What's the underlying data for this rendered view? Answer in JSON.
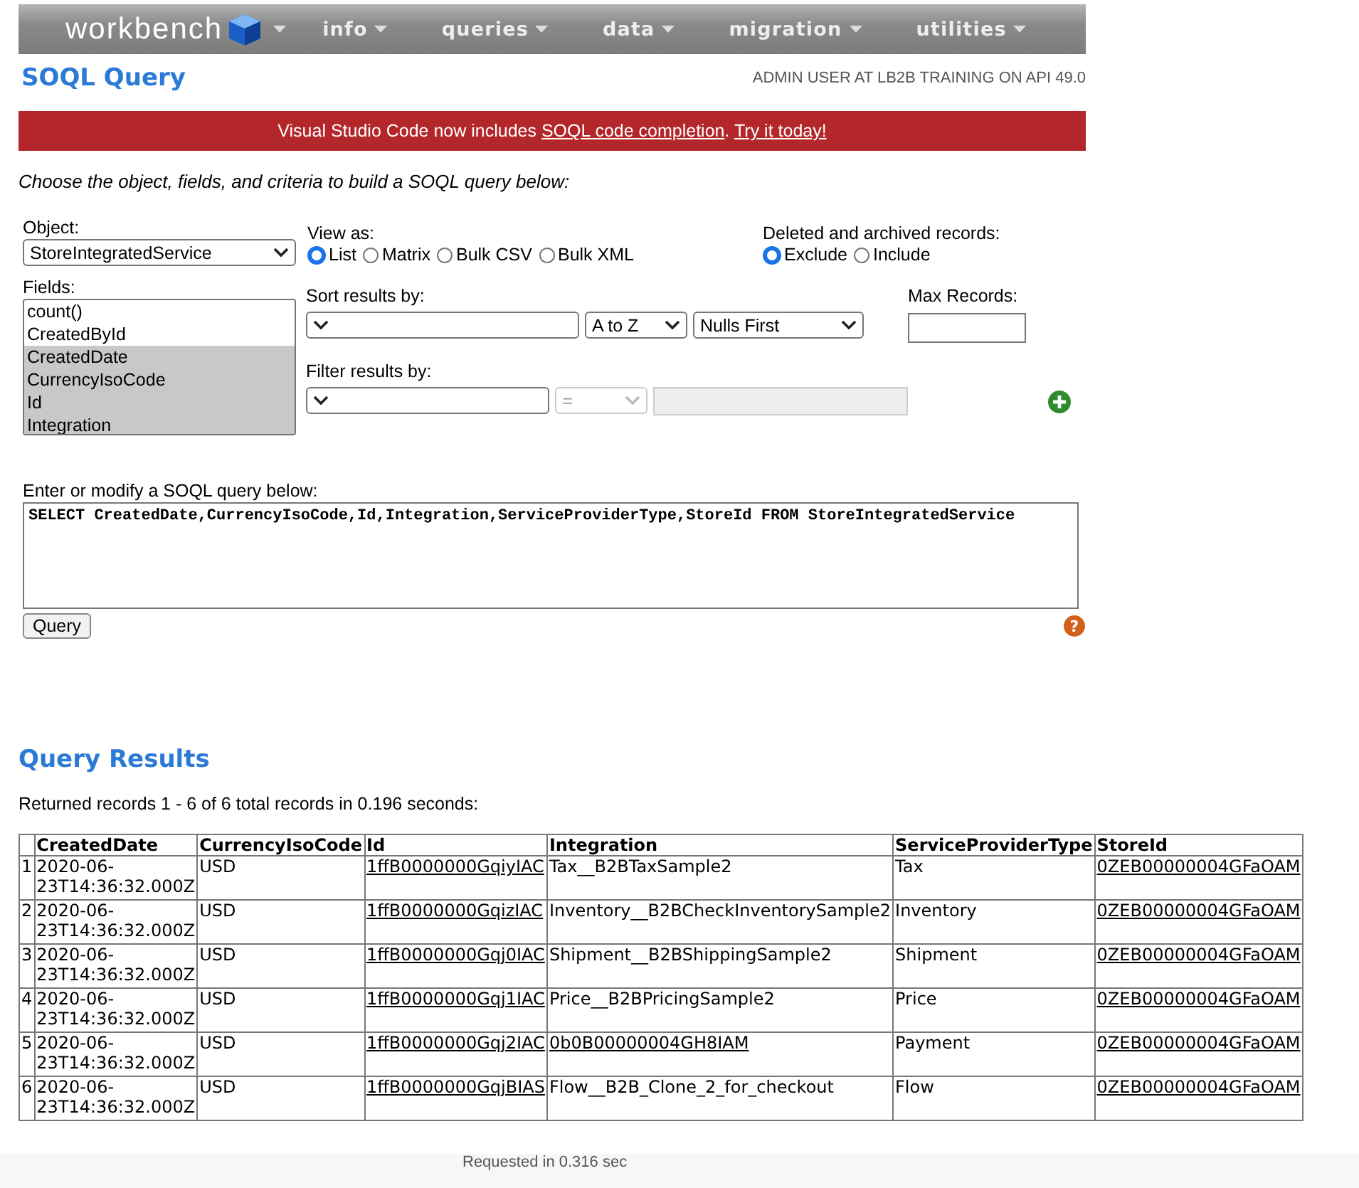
{
  "nav": {
    "logo": "workbench",
    "menus": [
      "info",
      "queries",
      "data",
      "migration",
      "utilities"
    ]
  },
  "header": {
    "title": "SOQL Query",
    "user": "ADMIN USER AT LB2B TRAINING ON API 49.0"
  },
  "banner": {
    "parts": [
      {
        "kind": "text",
        "text": "Visual Studio Code now includes "
      },
      {
        "kind": "link",
        "text": "SOQL code completion"
      },
      {
        "kind": "text",
        "text": ". "
      },
      {
        "kind": "link",
        "text": "Try it today!"
      }
    ]
  },
  "intro": "Choose the object, fields, and criteria to build a SOQL query below:",
  "object": {
    "label": "Object:",
    "value": "StoreIntegratedService"
  },
  "view_as": {
    "label": "View as:",
    "options": [
      {
        "label": "List",
        "selected": true
      },
      {
        "label": "Matrix",
        "selected": false
      },
      {
        "label": "Bulk CSV",
        "selected": false
      },
      {
        "label": "Bulk XML",
        "selected": false
      }
    ]
  },
  "deleted": {
    "label": "Deleted and archived records:",
    "options": [
      {
        "label": "Exclude",
        "selected": true
      },
      {
        "label": "Include",
        "selected": false
      }
    ]
  },
  "fields": {
    "label": "Fields:",
    "items": [
      {
        "label": "count()",
        "selected": false
      },
      {
        "label": "CreatedById",
        "selected": false
      },
      {
        "label": "CreatedDate",
        "selected": true
      },
      {
        "label": "CurrencyIsoCode",
        "selected": true
      },
      {
        "label": "Id",
        "selected": true
      },
      {
        "label": "Integration",
        "selected": true
      }
    ]
  },
  "sort": {
    "label": "Sort results by:",
    "direction": "A to Z",
    "nulls": "Nulls First"
  },
  "max_records": {
    "label": "Max Records:"
  },
  "filter": {
    "label": "Filter results by:",
    "operator": "=",
    "disabled": true
  },
  "query": {
    "label": "Enter or modify a SOQL query below:",
    "value": "SELECT CreatedDate,CurrencyIsoCode,Id,Integration,ServiceProviderType,StoreId FROM StoreIntegratedService",
    "button": "Query",
    "help": "?"
  },
  "results": {
    "title": "Query Results",
    "summary": "Returned records 1 - 6 of 6 total records in 0.196 seconds:",
    "columns": [
      "CreatedDate",
      "CurrencyIsoCode",
      "Id",
      "Integration",
      "ServiceProviderType",
      "StoreId"
    ],
    "rows": [
      {
        "number": "1",
        "cells": [
          {
            "text": "2020-06-23T14:36:32.000Z",
            "link": false
          },
          {
            "text": "USD",
            "link": false
          },
          {
            "text": "1ffB0000000GqiyIAC",
            "link": true
          },
          {
            "text": "Tax__B2BTaxSample2",
            "link": false
          },
          {
            "text": "Tax",
            "link": false
          },
          {
            "text": "0ZEB00000004GFaOAM",
            "link": true
          }
        ]
      },
      {
        "number": "2",
        "cells": [
          {
            "text": "2020-06-23T14:36:32.000Z",
            "link": false
          },
          {
            "text": "USD",
            "link": false
          },
          {
            "text": "1ffB0000000GqizIAC",
            "link": true
          },
          {
            "text": "Inventory__B2BCheckInventorySample2",
            "link": false
          },
          {
            "text": "Inventory",
            "link": false
          },
          {
            "text": "0ZEB00000004GFaOAM",
            "link": true
          }
        ]
      },
      {
        "number": "3",
        "cells": [
          {
            "text": "2020-06-23T14:36:32.000Z",
            "link": false
          },
          {
            "text": "USD",
            "link": false
          },
          {
            "text": "1ffB0000000Gqj0IAC",
            "link": true
          },
          {
            "text": "Shipment__B2BShippingSample2",
            "link": false
          },
          {
            "text": "Shipment",
            "link": false
          },
          {
            "text": "0ZEB00000004GFaOAM",
            "link": true
          }
        ]
      },
      {
        "number": "4",
        "cells": [
          {
            "text": "2020-06-23T14:36:32.000Z",
            "link": false
          },
          {
            "text": "USD",
            "link": false
          },
          {
            "text": "1ffB0000000Gqj1IAC",
            "link": true
          },
          {
            "text": "Price__B2BPricingSample2",
            "link": false
          },
          {
            "text": "Price",
            "link": false
          },
          {
            "text": "0ZEB00000004GFaOAM",
            "link": true
          }
        ]
      },
      {
        "number": "5",
        "cells": [
          {
            "text": "2020-06-23T14:36:32.000Z",
            "link": false
          },
          {
            "text": "USD",
            "link": false
          },
          {
            "text": "1ffB0000000Gqj2IAC",
            "link": true
          },
          {
            "text": "0b0B00000004GH8IAM",
            "link": true
          },
          {
            "text": "Payment",
            "link": false
          },
          {
            "text": "0ZEB00000004GFaOAM",
            "link": true
          }
        ]
      },
      {
        "number": "6",
        "cells": [
          {
            "text": "2020-06-23T14:36:32.000Z",
            "link": false
          },
          {
            "text": "USD",
            "link": false
          },
          {
            "text": "1ffB0000000GqjBIAS",
            "link": true
          },
          {
            "text": "Flow__B2B_Clone_2_for_checkout",
            "link": false
          },
          {
            "text": "Flow",
            "link": false
          },
          {
            "text": "0ZEB00000004GFaOAM",
            "link": true
          }
        ]
      }
    ]
  },
  "footer": "Requested in 0.316 sec"
}
